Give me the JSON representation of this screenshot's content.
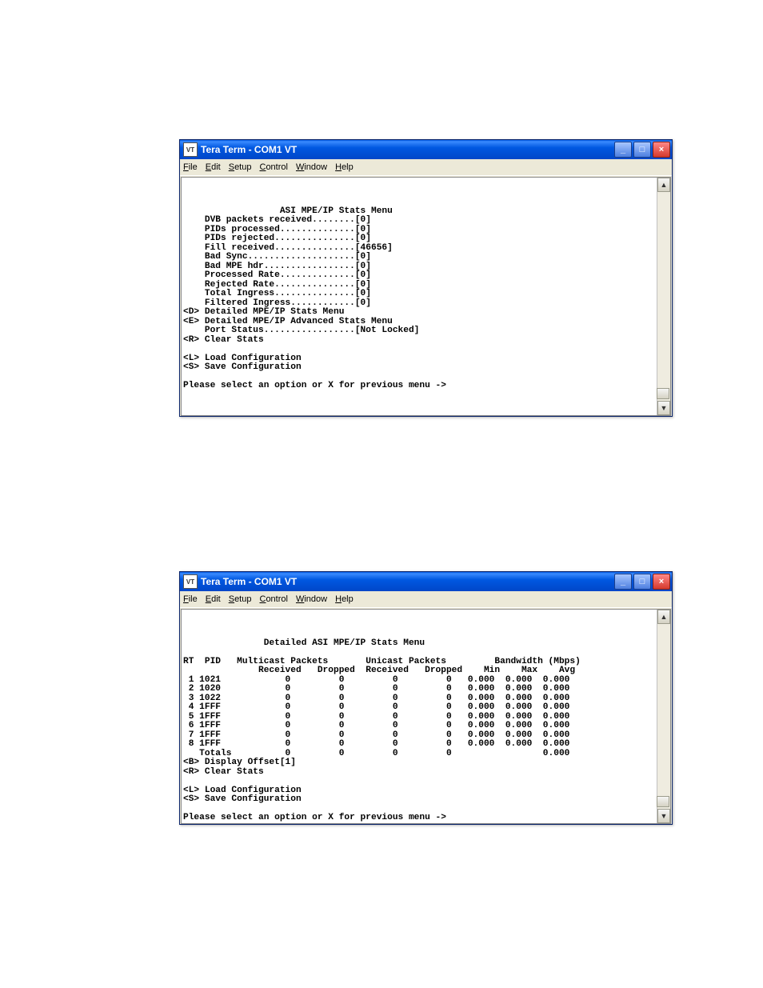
{
  "appname": "Tera Term - COM1 VT",
  "menus": [
    "File",
    "Edit",
    "Setup",
    "Control",
    "Window",
    "Help"
  ],
  "screen1": {
    "title": "ASI MPE/IP Stats Menu",
    "stats": [
      {
        "label": "DVB packets received",
        "value": "0"
      },
      {
        "label": "PIDs processed",
        "value": "0"
      },
      {
        "label": "PIDs rejected",
        "value": "0"
      },
      {
        "label": "Fill received",
        "value": "46656"
      },
      {
        "label": "Bad Sync",
        "value": "0"
      },
      {
        "label": "Bad MPE hdr",
        "value": "0"
      },
      {
        "label": "Processed Rate",
        "value": "0"
      },
      {
        "label": "Rejected Rate",
        "value": "0"
      },
      {
        "label": "Total Ingress",
        "value": "0"
      },
      {
        "label": "Filtered Ingress",
        "value": "0"
      }
    ],
    "items": [
      "<D> Detailed MPE/IP Stats Menu",
      "<E> Detailed MPE/IP Advanced Stats Menu"
    ],
    "port_status_label": "Port Status",
    "port_status_value": "Not Locked",
    "bottom_items": [
      "<R> Clear Stats",
      "",
      "<L> Load Configuration",
      "<S> Save Configuration"
    ],
    "prompt": "Please select an option or X for previous menu ->"
  },
  "screen2": {
    "title": "Detailed ASI MPE/IP Stats Menu",
    "header_top": [
      "RT",
      "PID",
      "Multicast Packets",
      "Unicast Packets",
      "Bandwidth (Mbps)"
    ],
    "header_sub": [
      "",
      "",
      "Received",
      "Dropped",
      "Received",
      "Dropped",
      "Min",
      "Max",
      "Avg"
    ],
    "rows": [
      {
        "rt": "1",
        "pid": "1021",
        "mr": "0",
        "md": "0",
        "ur": "0",
        "ud": "0",
        "min": "0.000",
        "max": "0.000",
        "avg": "0.000"
      },
      {
        "rt": "2",
        "pid": "1020",
        "mr": "0",
        "md": "0",
        "ur": "0",
        "ud": "0",
        "min": "0.000",
        "max": "0.000",
        "avg": "0.000"
      },
      {
        "rt": "3",
        "pid": "1022",
        "mr": "0",
        "md": "0",
        "ur": "0",
        "ud": "0",
        "min": "0.000",
        "max": "0.000",
        "avg": "0.000"
      },
      {
        "rt": "4",
        "pid": "1FFF",
        "mr": "0",
        "md": "0",
        "ur": "0",
        "ud": "0",
        "min": "0.000",
        "max": "0.000",
        "avg": "0.000"
      },
      {
        "rt": "5",
        "pid": "1FFF",
        "mr": "0",
        "md": "0",
        "ur": "0",
        "ud": "0",
        "min": "0.000",
        "max": "0.000",
        "avg": "0.000"
      },
      {
        "rt": "6",
        "pid": "1FFF",
        "mr": "0",
        "md": "0",
        "ur": "0",
        "ud": "0",
        "min": "0.000",
        "max": "0.000",
        "avg": "0.000"
      },
      {
        "rt": "7",
        "pid": "1FFF",
        "mr": "0",
        "md": "0",
        "ur": "0",
        "ud": "0",
        "min": "0.000",
        "max": "0.000",
        "avg": "0.000"
      },
      {
        "rt": "8",
        "pid": "1FFF",
        "mr": "0",
        "md": "0",
        "ur": "0",
        "ud": "0",
        "min": "0.000",
        "max": "0.000",
        "avg": "0.000"
      }
    ],
    "totals": {
      "label": "Totals",
      "mr": "0",
      "md": "0",
      "ur": "0",
      "ud": "0",
      "avg": "0.000"
    },
    "bottom_items": [
      "<B> Display Offset[1]",
      "<R> Clear Stats",
      "",
      "<L> Load Configuration",
      "<S> Save Configuration"
    ],
    "prompt": "Please select an option or X for previous menu ->"
  }
}
